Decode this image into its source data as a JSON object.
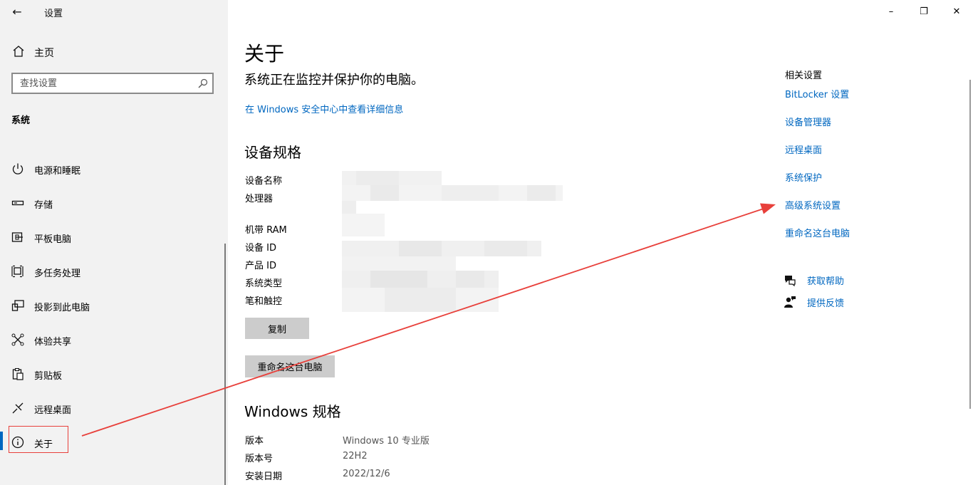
{
  "window": {
    "back_label": "←",
    "title": "设置",
    "minimize_glyph": "–",
    "restore_glyph": "❐",
    "close_glyph": "✕"
  },
  "sidebar": {
    "home_label": "主页",
    "search_placeholder": "查找设置",
    "section_title": "系统",
    "items": [
      {
        "label": "电源和睡眠",
        "icon": "power-icon"
      },
      {
        "label": "存储",
        "icon": "storage-icon"
      },
      {
        "label": "平板电脑",
        "icon": "tablet-icon"
      },
      {
        "label": "多任务处理",
        "icon": "multitask-icon"
      },
      {
        "label": "投影到此电脑",
        "icon": "project-icon"
      },
      {
        "label": "体验共享",
        "icon": "share-icon"
      },
      {
        "label": "剪贴板",
        "icon": "clipboard-icon"
      },
      {
        "label": "远程桌面",
        "icon": "remote-icon"
      },
      {
        "label": "关于",
        "icon": "info-icon",
        "selected": true
      }
    ]
  },
  "main": {
    "title": "关于",
    "status": "系统正在监控并保护你的电脑。",
    "security_link": "在 Windows 安全中心中查看详细信息",
    "device_specs": {
      "heading": "设备规格",
      "labels": [
        "设备名称",
        "处理器",
        "机带 RAM",
        "设备 ID",
        "产品 ID",
        "系统类型",
        "笔和触控"
      ],
      "copy_button": "复制",
      "rename_button": "重命名这台电脑"
    },
    "windows_specs": {
      "heading": "Windows 规格",
      "rows": [
        {
          "label": "版本",
          "value": "Windows 10 专业版"
        },
        {
          "label": "版本号",
          "value": "22H2"
        },
        {
          "label": "安装日期",
          "value": "2022/12/6"
        }
      ]
    }
  },
  "related": {
    "title": "相关设置",
    "links": [
      "BitLocker 设置",
      "设备管理器",
      "远程桌面",
      "系统保护",
      "高级系统设置",
      "重命名这台电脑"
    ],
    "help_label": "获取帮助",
    "feedback_label": "提供反馈"
  },
  "colors": {
    "accent": "#0067c0",
    "sidebar_bg": "#f2f2f2",
    "annotation": "#e8403b",
    "button_bg": "#cccccc"
  }
}
